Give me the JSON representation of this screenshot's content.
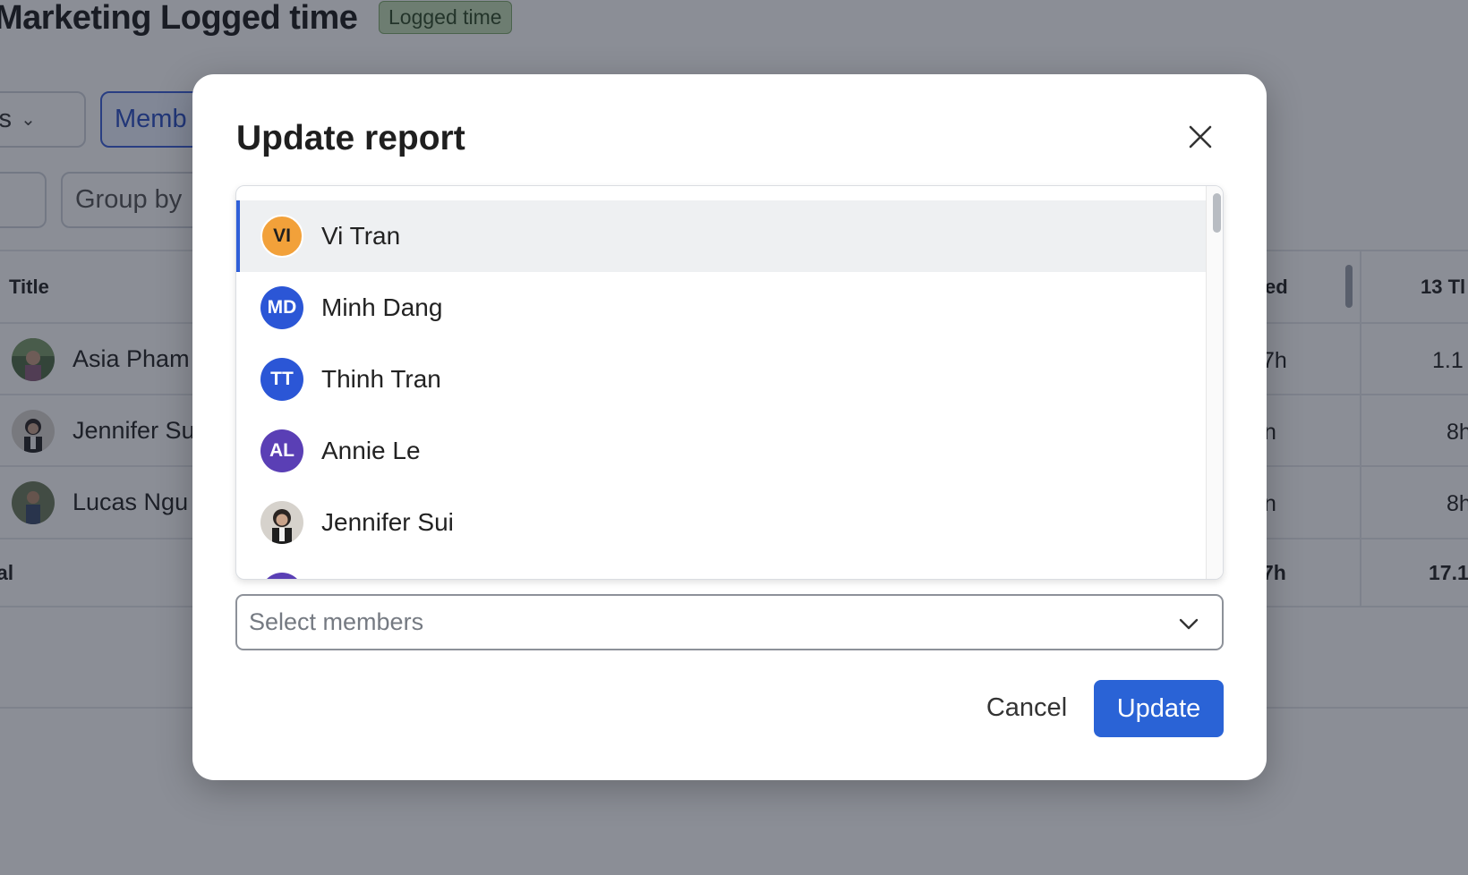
{
  "page": {
    "title": "Marketing Logged time",
    "badge": "Logged time",
    "filters": {
      "projects_label": "cts",
      "members_label": "Memb",
      "group_by_label": "Group by"
    },
    "table": {
      "headers": {
        "title": "Title",
        "logged": "ed",
        "day": "13 Tl"
      },
      "rows": [
        {
          "name": "Asia Pham",
          "logged": "7h",
          "day": "1.1"
        },
        {
          "name": "Jennifer Su",
          "logged": "n",
          "day": "8h"
        },
        {
          "name": "Lucas Ngu",
          "logged": "n",
          "day": "8h"
        }
      ],
      "total": {
        "label": "al",
        "logged": "7h",
        "day": "17.1"
      }
    }
  },
  "modal": {
    "title": "Update report",
    "close_icon": "close-icon",
    "members": [
      {
        "initials": "VI",
        "name": "Vi Tran",
        "color": "#f2a13a",
        "text_color": "#1f1f1f",
        "selected": true
      },
      {
        "initials": "MD",
        "name": "Minh Dang",
        "color": "#2b56d6",
        "text_color": "#ffffff"
      },
      {
        "initials": "TT",
        "name": "Thinh Tran",
        "color": "#2b56d6",
        "text_color": "#ffffff"
      },
      {
        "initials": "AL",
        "name": "Annie Le",
        "color": "#5a3fb5",
        "text_color": "#ffffff"
      },
      {
        "initials": "",
        "name": "Jennifer Sui",
        "photo": true
      },
      {
        "initials": "",
        "name": "",
        "color": "#5a3fb5"
      }
    ],
    "select": {
      "placeholder": "Select members"
    },
    "buttons": {
      "cancel": "Cancel",
      "update": "Update"
    },
    "colors": {
      "primary": "#2a63d6",
      "active_row": "#eef0f2"
    }
  }
}
